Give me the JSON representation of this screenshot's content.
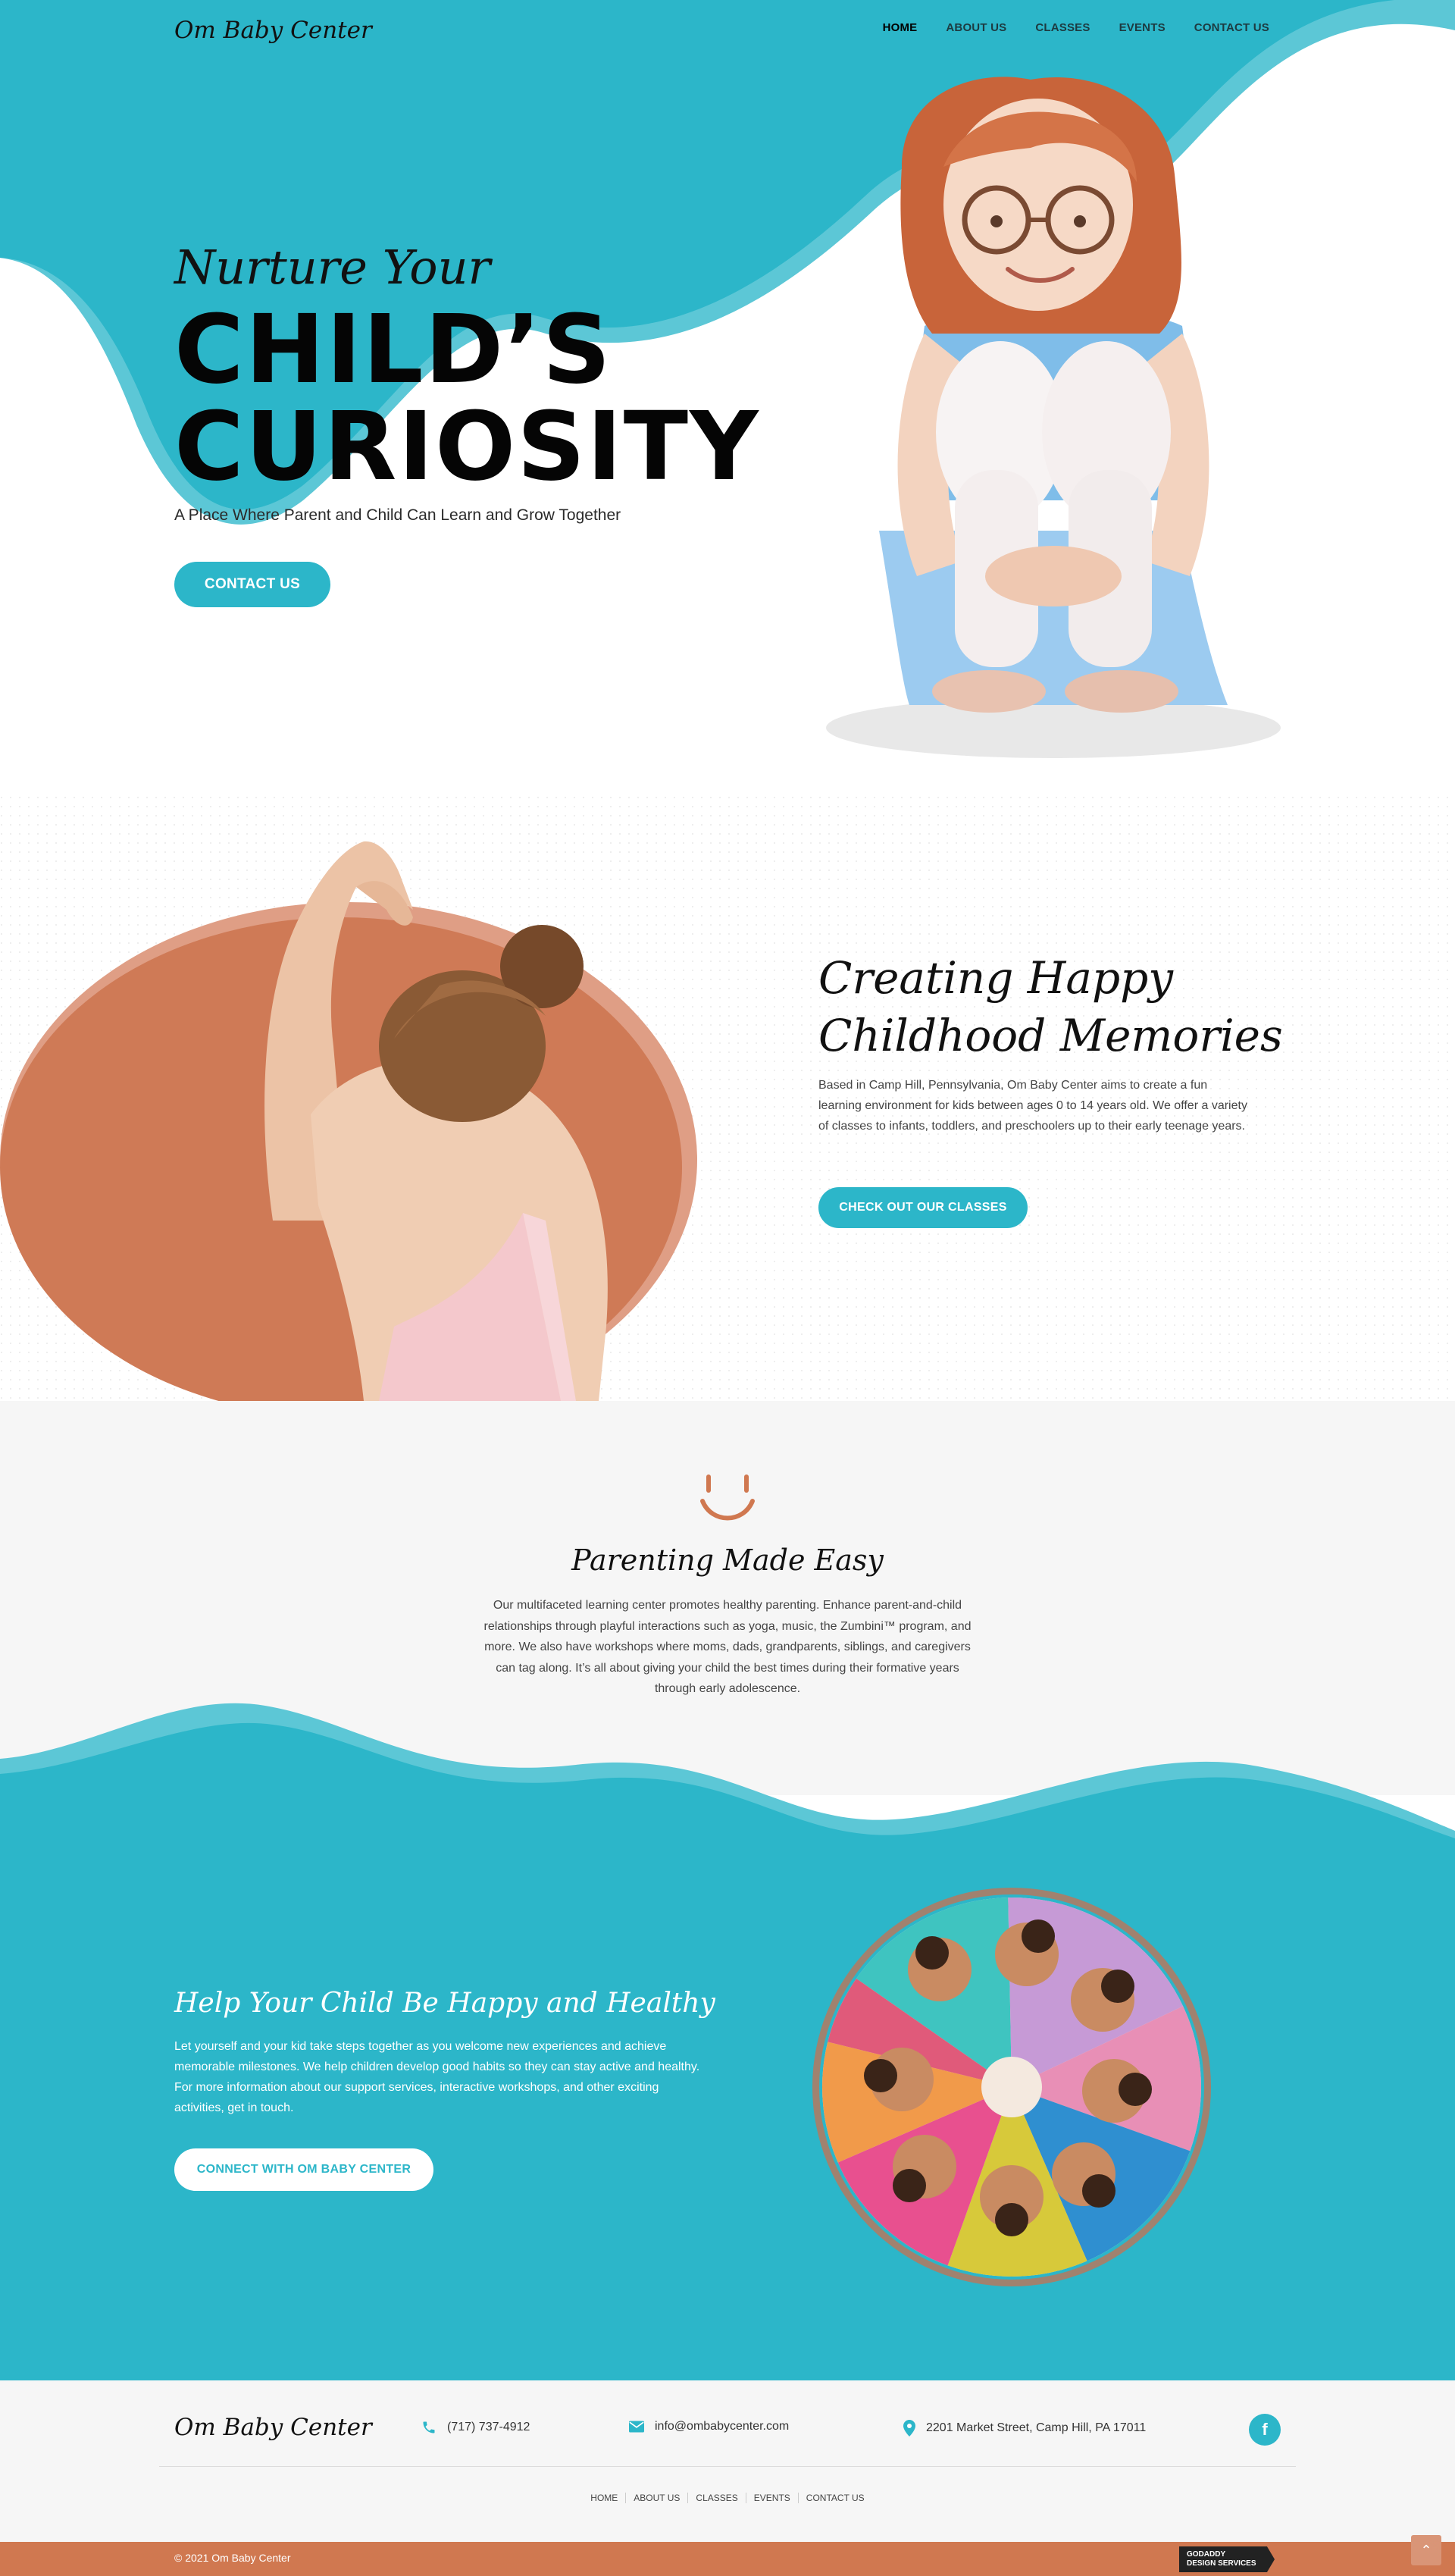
{
  "header": {
    "logo": "Om Baby Center",
    "nav": [
      "HOME",
      "ABOUT US",
      "CLASSES",
      "EVENTS",
      "CONTACT US"
    ]
  },
  "hero": {
    "subtitle": "Nurture Your",
    "title_line1": "CHILD’S",
    "title_line2": "CURIOSITY",
    "tagline": "A Place Where Parent and Child Can Learn and Grow Together",
    "button": "CONTACT US"
  },
  "about": {
    "title_line1": "Creating Happy",
    "title_line2": "Childhood Memories",
    "text": "Based in Camp Hill, Pennsylvania, Om Baby Center aims to create a fun learning environment for kids between ages 0 to 14 years old. We offer a variety of classes to infants, toddlers, and preschoolers up to their early teenage years.",
    "button": "CHECK OUT OUR CLASSES"
  },
  "parenting": {
    "title": "Parenting Made Easy",
    "text": "Our multifaceted learning center promotes healthy parenting. Enhance parent-and-child relationships through playful interactions such as yoga, music, the Zumbini™ program, and more. We also have workshops where moms, dads, grandparents, siblings, and caregivers can tag along. It’s all about giving your child the best times during their formative years through early adolescence."
  },
  "healthy": {
    "title": "Help Your Child Be Happy and Healthy",
    "text": "Let yourself and your kid take steps together as you welcome new experiences and achieve memorable milestones. We help children develop good habits so they can stay active and healthy. For more information about our support services, interactive workshops, and other exciting activities, get in touch.",
    "button": "CONNECT WITH OM BABY CENTER"
  },
  "footer": {
    "logo": "Om Baby Center",
    "phone": "(717) 737-4912",
    "email": "info@ombabycenter.com",
    "address": "2201 Market Street, Camp Hill, PA 17011",
    "social": "f",
    "nav": [
      "HOME",
      "ABOUT US",
      "CLASSES",
      "EVENTS",
      "CONTACT US"
    ],
    "copyright": "© 2021 Om Baby Center",
    "badge_line1": "GODADDY",
    "badge_line2": "DESIGN SERVICES"
  },
  "colors": {
    "teal": "#2cb6c9",
    "teal_light": "#5cc7d6",
    "terracotta": "#d07850",
    "footer_bg": "#f6f6f6"
  },
  "icons": [
    "phone-icon",
    "mail-icon",
    "location-pin-icon",
    "facebook-icon",
    "smile-icon",
    "arrow-up-icon"
  ]
}
